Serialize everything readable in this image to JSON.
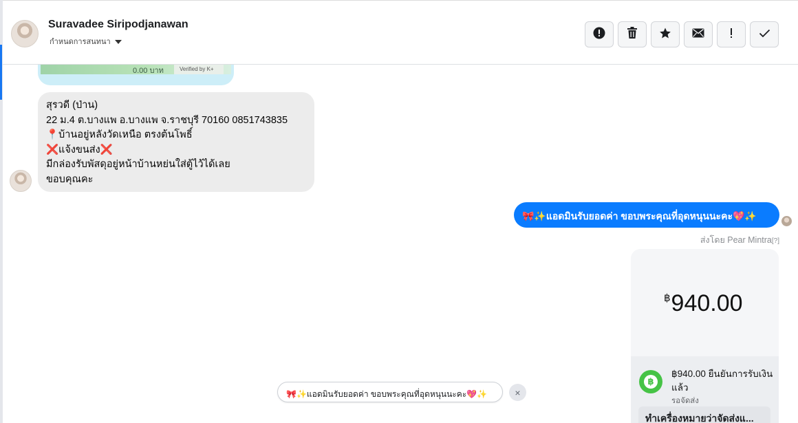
{
  "header": {
    "contact_name": "Suravadee Siripodjanawan",
    "conversation_setting": "กำหนดการสนทนา",
    "toolbar": [
      {
        "name": "report-button",
        "icon": "!",
        "title": "report"
      },
      {
        "name": "delete-button",
        "icon": "🗑",
        "title": "delete"
      },
      {
        "name": "star-button",
        "icon": "★",
        "title": "star"
      },
      {
        "name": "mark-unread-button",
        "icon": "✉",
        "title": "mark unread"
      },
      {
        "name": "important-button",
        "icon": "!",
        "title": "important"
      },
      {
        "name": "done-button",
        "icon": "✓",
        "title": "done"
      }
    ]
  },
  "attachment_preview": {
    "amount": "0.00 บาท",
    "verified": "Verified by K+"
  },
  "incoming_message": {
    "lines": [
      "สุรวดี (ป่าน)",
      "22 ม.4 ต.บางแพ อ.บางแพ จ.ราชบุรี 70160 0851743835",
      "📍บ้านอยู่หลังวัดเหนือ ตรงต้นโพธิ์",
      "❌แจ้งขนส่ง❌",
      "มีกล่องรับพัสดุอยู่หน้าบ้านหย่นใส่ตู้ไว้ได้เลย",
      "ขอบคุณคะ"
    ]
  },
  "outgoing_message": {
    "text": "🎀✨แอดมินรับยอดค่า ขอบพระคุณที่อุดหนุนนะคะ💖✨",
    "sent_by": "ส่งโดย Pear Mintra",
    "sent_by_help": "[?]"
  },
  "payment_card": {
    "currency_symbol": "฿",
    "amount": "940.00",
    "status": "฿940.00 ยืนยันการรับเงินแล้ว",
    "sub_status": "รอจัดส่ง",
    "action_label": "ทำเครื่องหมายว่าจัดส่งแ..."
  },
  "quick_reply": {
    "text": "🎀✨แอดมินรับยอดค่า ขอบพระคุณที่อุดหนุนนะคะ💖✨",
    "close_icon": "×"
  }
}
